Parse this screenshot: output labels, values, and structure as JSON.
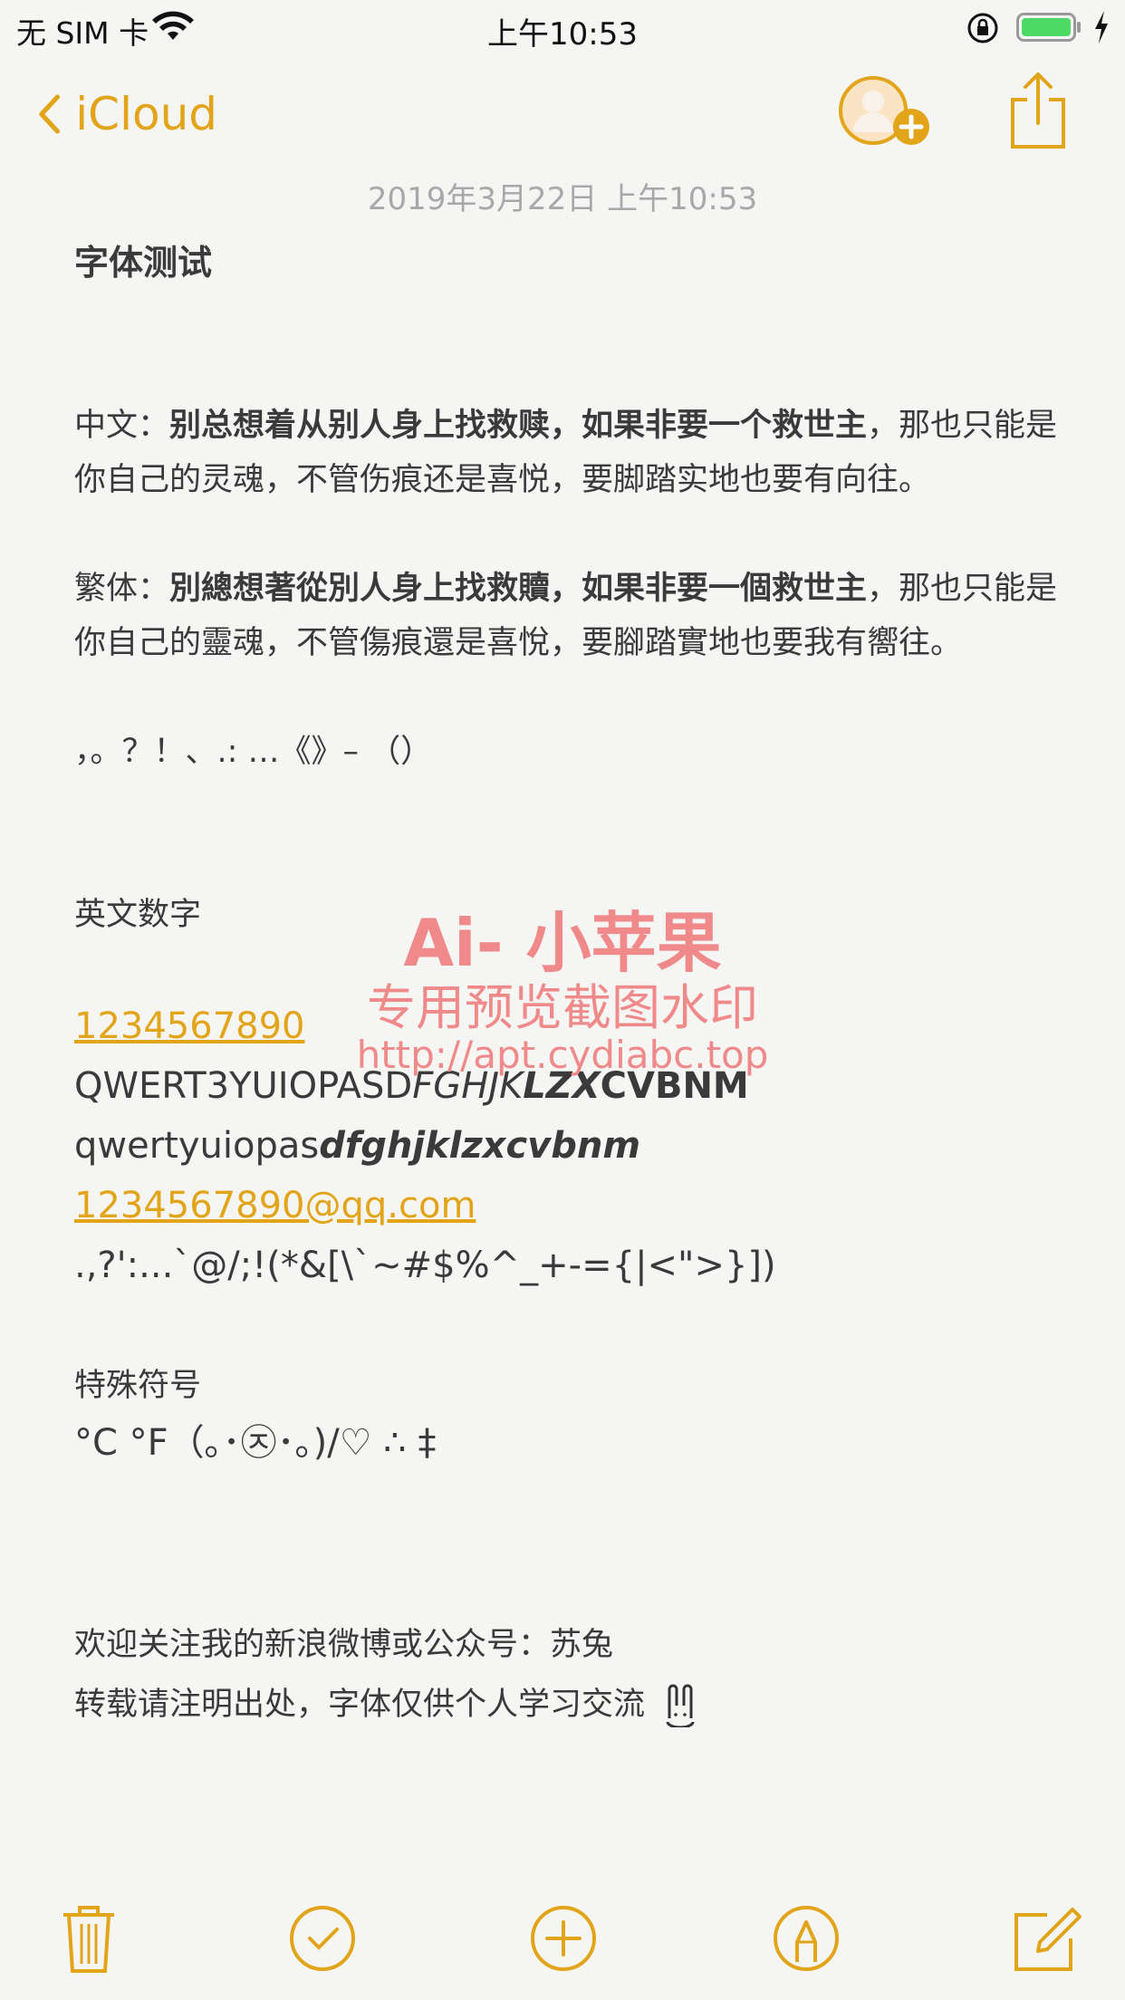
{
  "status_bar": {
    "carrier": "无 SIM 卡",
    "time": "上午10:53"
  },
  "nav": {
    "back_label": "iCloud"
  },
  "note": {
    "timestamp": "2019年3月22日 上午10:53",
    "title": "字体测试",
    "zh_label": "中文：",
    "zh_bold": "别总想着从别人身上找救赎，如果非要一个救世主",
    "zh_rest": "，那也只能是",
    "zh_line2": "你自己的灵魂，不管伤痕还是喜悦，要脚踏实地也要有向往。",
    "zht_label": "繁体：",
    "zht_bold": "別總想著從別人身上找救贖，如果非要一個救世主",
    "zht_rest": "，那也只能是",
    "zht_line2": "你自己的靈魂，不管傷痕還是喜悅，要腳踏實地也要我有嚮往。",
    "punct": "，。？！、.: …《》– （）",
    "en_heading": "英文数字",
    "digits_link": "1234567890",
    "upper_plain": "QWERT3YUIOPASD",
    "upper_italic": "FGHJK",
    "upper_bold_italic": "LZX",
    "upper_bold": "CVBNM",
    "lower_plain": "qwertyuiopas",
    "lower_bold_italic": "dfghjklzxcvbnm",
    "email_link": "1234567890@qq.com",
    "symbols": ".,?':...`@/;!(*&[\\`~#$%^_+-={|<\">}])",
    "special_heading": "特殊符号",
    "special_symbols": "°C  °F（｡･㉨･｡)/♡ ∴ ‡",
    "follow_line": "欢迎关注我的新浪微博或公众号：苏兔",
    "repost_line": "转载请注明出处，字体仅供个人学习交流"
  },
  "watermark": {
    "line1": "Ai- 小苹果",
    "line2": "专用预览截图水印",
    "line3": "http://apt.cydiabc.top"
  },
  "colors": {
    "accent": "#e2a418",
    "watermark": "#f08a8a",
    "background": "#f5f5f3"
  },
  "icons": {
    "toolbar": [
      "trash-icon",
      "checklist-icon",
      "add-icon",
      "markup-icon",
      "compose-icon"
    ],
    "nav": [
      "chevron-left-icon",
      "add-person-icon",
      "share-icon"
    ]
  }
}
